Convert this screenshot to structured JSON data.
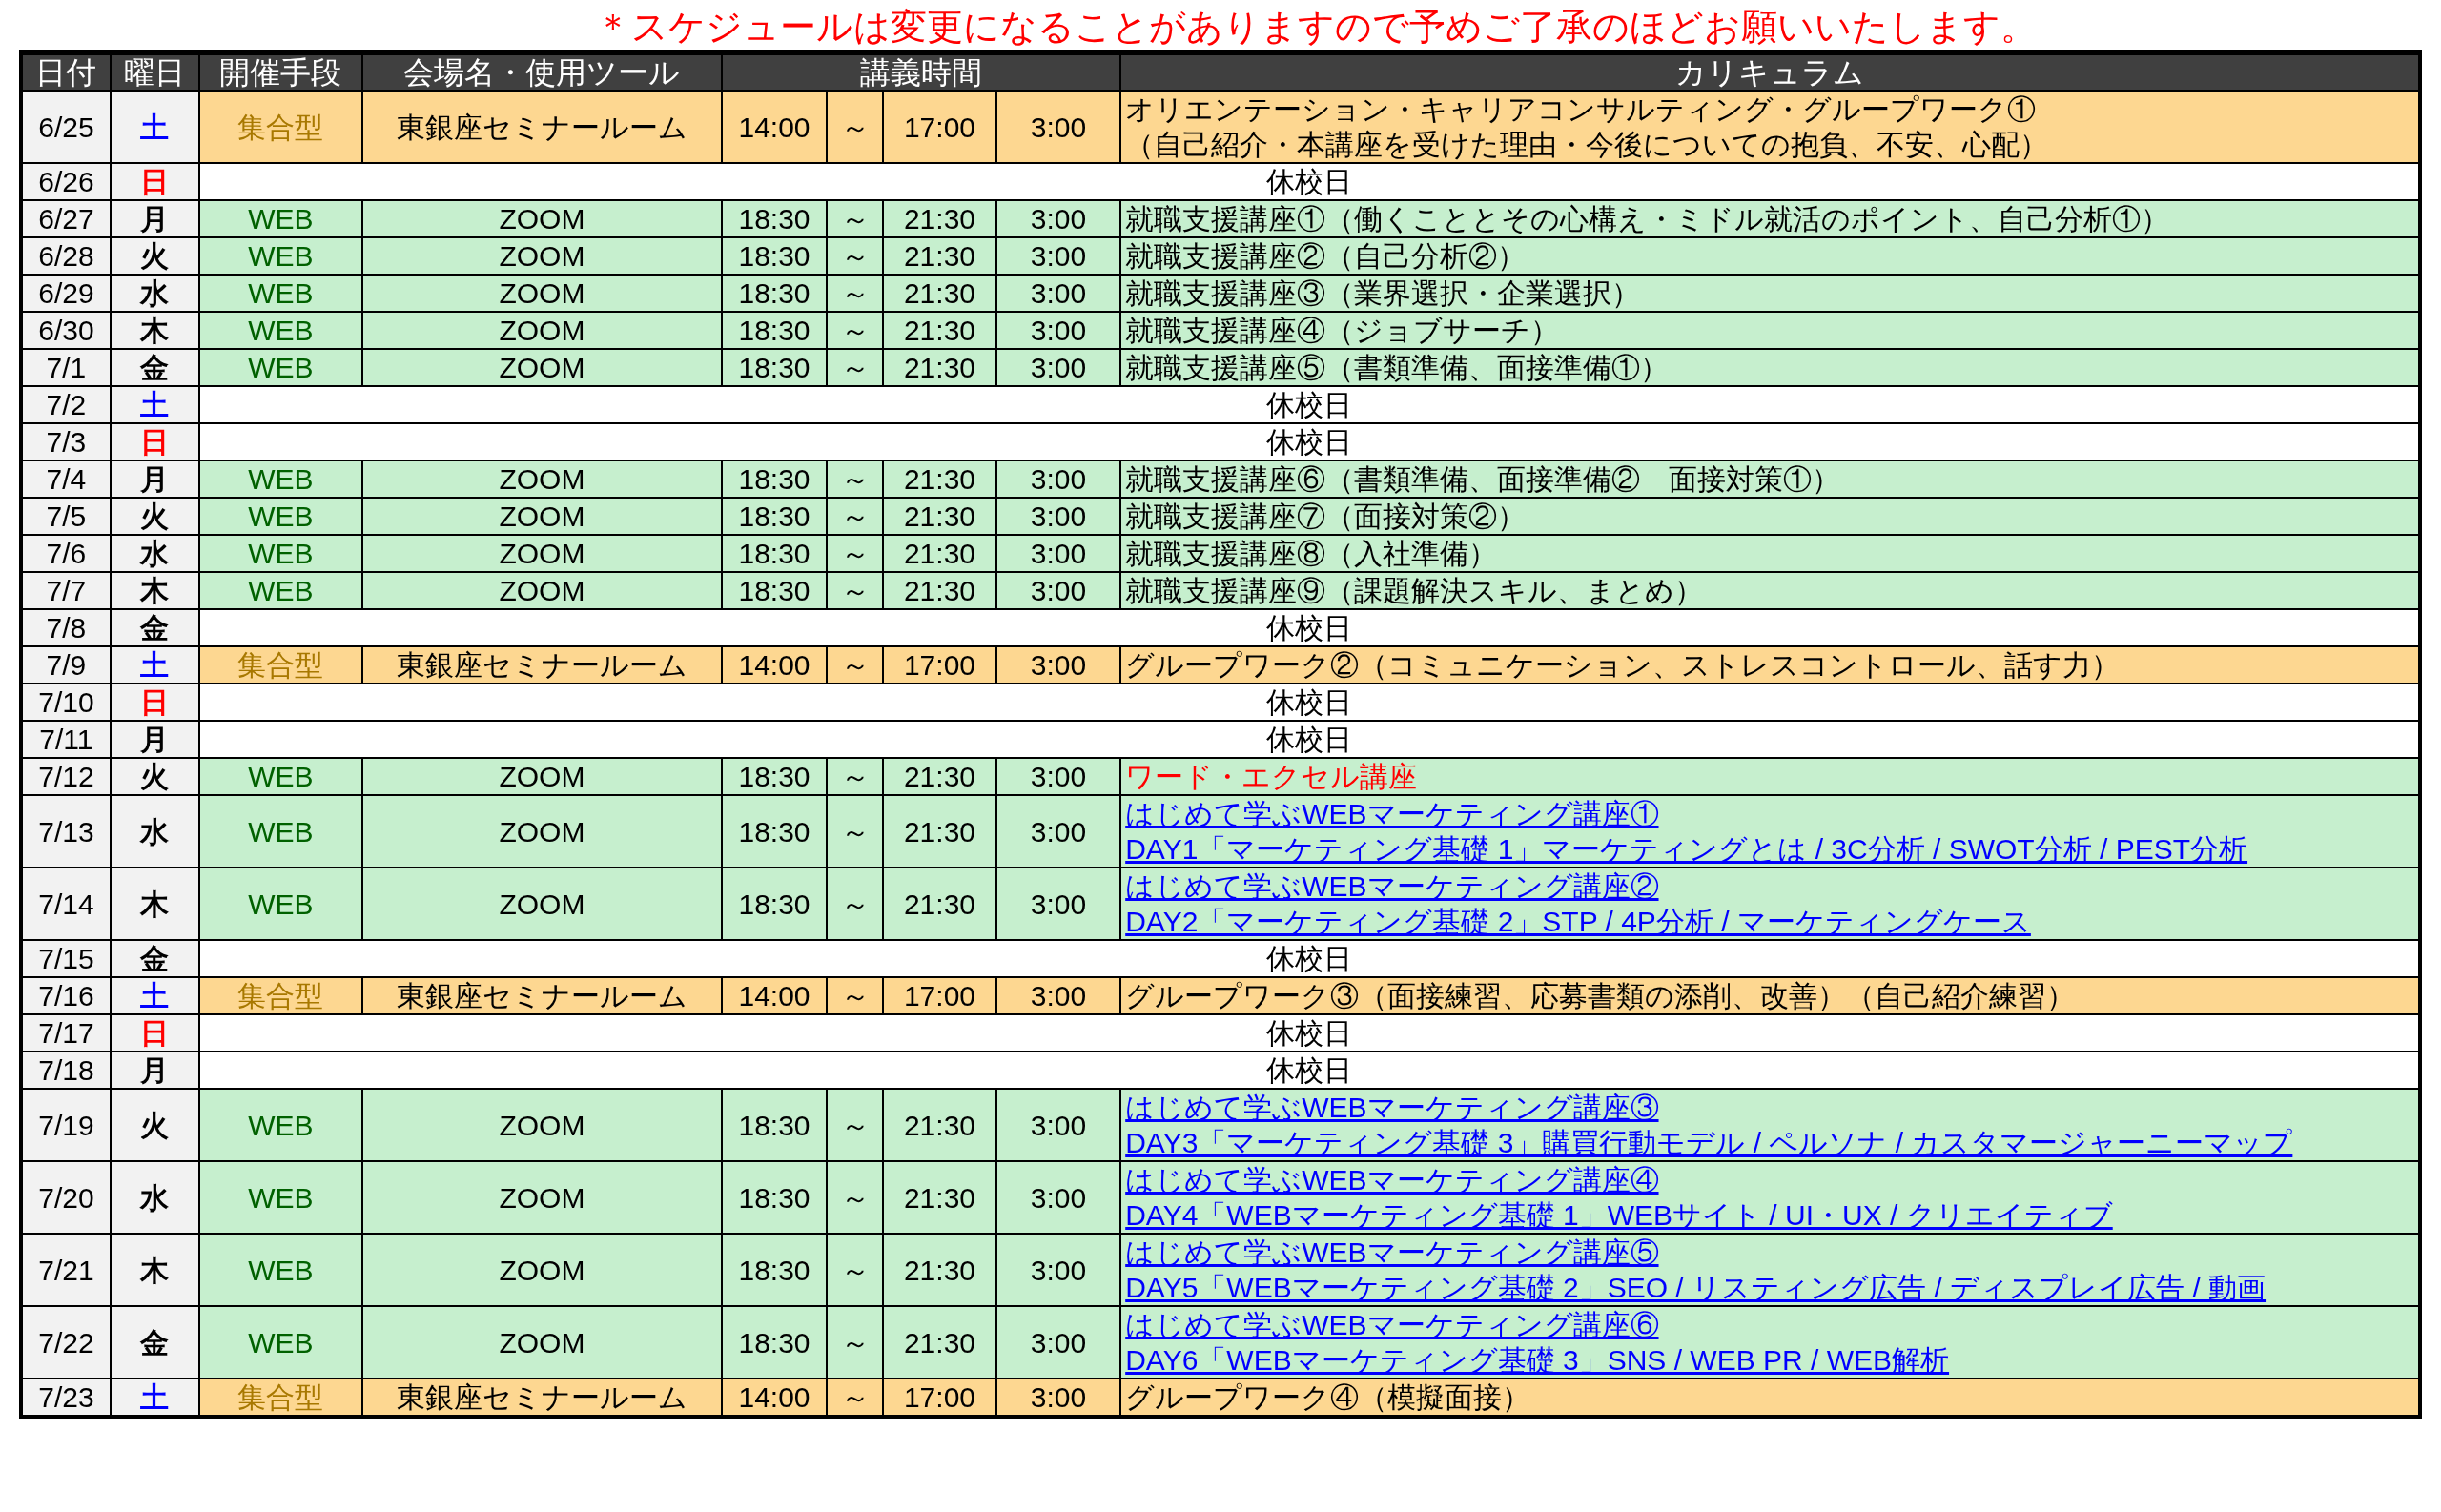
{
  "notice": "＊スケジュールは変更になることがありますので予めご了承のほどお願いいたします。",
  "header": [
    {
      "text": "日付",
      "kind": "single"
    },
    {
      "text": "曜日",
      "kind": "single"
    },
    {
      "text": "開催手段",
      "kind": "single"
    },
    {
      "text": "会場名・使用ツール",
      "kind": "single"
    },
    {
      "text": "講義時間",
      "kind": "time_group"
    },
    {
      "text": "カリキュラム",
      "kind": "single"
    }
  ],
  "rows": [
    {
      "kind": "in_person",
      "date": "6/25",
      "weekday": {
        "text": "土",
        "color": "#0000ff"
      },
      "mode": "集合型",
      "venue": "東銀座セミナールーム",
      "start": "14:00",
      "tilde": "～",
      "end": "17:00",
      "duration": "3:00",
      "curriculum": [
        {
          "kind": "plain",
          "text": "オリエンテーション・キャリアコンサルティング・グループワーク①"
        },
        {
          "kind": "plain",
          "text": "（自己紹介・本講座を受けた理由・今後についての抱負、不安、心配）"
        }
      ]
    },
    {
      "kind": "holiday",
      "date": "6/26",
      "weekday": {
        "text": "日",
        "color": "#ff0000"
      },
      "note": "休校日"
    },
    {
      "kind": "web",
      "date": "6/27",
      "weekday": {
        "text": "月",
        "color": "#000000"
      },
      "mode": "WEB",
      "venue": "ZOOM",
      "start": "18:30",
      "tilde": "～",
      "end": "21:30",
      "duration": "3:00",
      "curriculum": [
        {
          "kind": "plain",
          "text": "就職支援講座①（働くこととその心構え・ミドル就活のポイント、自己分析①）"
        }
      ]
    },
    {
      "kind": "web",
      "date": "6/28",
      "weekday": {
        "text": "火",
        "color": "#000000"
      },
      "mode": "WEB",
      "venue": "ZOOM",
      "start": "18:30",
      "tilde": "～",
      "end": "21:30",
      "duration": "3:00",
      "curriculum": [
        {
          "kind": "plain",
          "text": "就職支援講座②（自己分析②）"
        }
      ]
    },
    {
      "kind": "web",
      "date": "6/29",
      "weekday": {
        "text": "水",
        "color": "#000000"
      },
      "mode": "WEB",
      "venue": "ZOOM",
      "start": "18:30",
      "tilde": "～",
      "end": "21:30",
      "duration": "3:00",
      "curriculum": [
        {
          "kind": "plain",
          "text": "就職支援講座③（業界選択・企業選択）"
        }
      ]
    },
    {
      "kind": "web",
      "date": "6/30",
      "weekday": {
        "text": "木",
        "color": "#000000"
      },
      "mode": "WEB",
      "venue": "ZOOM",
      "start": "18:30",
      "tilde": "～",
      "end": "21:30",
      "duration": "3:00",
      "curriculum": [
        {
          "kind": "plain",
          "text": "就職支援講座④（ジョブサーチ）"
        }
      ]
    },
    {
      "kind": "web",
      "date": "7/1",
      "weekday": {
        "text": "金",
        "color": "#000000"
      },
      "mode": "WEB",
      "venue": "ZOOM",
      "start": "18:30",
      "tilde": "～",
      "end": "21:30",
      "duration": "3:00",
      "curriculum": [
        {
          "kind": "plain",
          "text": "就職支援講座⑤（書類準備、面接準備①）"
        }
      ]
    },
    {
      "kind": "holiday",
      "date": "7/2",
      "weekday": {
        "text": "土",
        "color": "#0000ff"
      },
      "note": "休校日"
    },
    {
      "kind": "holiday",
      "date": "7/3",
      "weekday": {
        "text": "日",
        "color": "#ff0000"
      },
      "note": "休校日"
    },
    {
      "kind": "web",
      "date": "7/4",
      "weekday": {
        "text": "月",
        "color": "#000000"
      },
      "mode": "WEB",
      "venue": "ZOOM",
      "start": "18:30",
      "tilde": "～",
      "end": "21:30",
      "duration": "3:00",
      "curriculum": [
        {
          "kind": "plain",
          "text": "就職支援講座⑥（書類準備、面接準備②　面接対策①）"
        }
      ]
    },
    {
      "kind": "web",
      "date": "7/5",
      "weekday": {
        "text": "火",
        "color": "#000000"
      },
      "mode": "WEB",
      "venue": "ZOOM",
      "start": "18:30",
      "tilde": "～",
      "end": "21:30",
      "duration": "3:00",
      "curriculum": [
        {
          "kind": "plain",
          "text": "就職支援講座⑦（面接対策②）"
        }
      ]
    },
    {
      "kind": "web",
      "date": "7/6",
      "weekday": {
        "text": "水",
        "color": "#000000"
      },
      "mode": "WEB",
      "venue": "ZOOM",
      "start": "18:30",
      "tilde": "～",
      "end": "21:30",
      "duration": "3:00",
      "curriculum": [
        {
          "kind": "plain",
          "text": "就職支援講座⑧（入社準備）"
        }
      ]
    },
    {
      "kind": "web",
      "date": "7/7",
      "weekday": {
        "text": "木",
        "color": "#000000"
      },
      "mode": "WEB",
      "venue": "ZOOM",
      "start": "18:30",
      "tilde": "～",
      "end": "21:30",
      "duration": "3:00",
      "curriculum": [
        {
          "kind": "plain",
          "text": "就職支援講座⑨（課題解決スキル、まとめ）"
        }
      ]
    },
    {
      "kind": "holiday",
      "date": "7/8",
      "weekday": {
        "text": "金",
        "color": "#000000"
      },
      "note": "休校日"
    },
    {
      "kind": "in_person",
      "date": "7/9",
      "weekday": {
        "text": "土",
        "color": "#0000ff"
      },
      "mode": "集合型",
      "venue": "東銀座セミナールーム",
      "start": "14:00",
      "tilde": "～",
      "end": "17:00",
      "duration": "3:00",
      "curriculum": [
        {
          "kind": "plain",
          "text": "グループワーク②（コミュニケーション、ストレスコントロール、話す力）"
        }
      ]
    },
    {
      "kind": "holiday",
      "date": "7/10",
      "weekday": {
        "text": "日",
        "color": "#ff0000"
      },
      "note": "休校日"
    },
    {
      "kind": "holiday",
      "date": "7/11",
      "weekday": {
        "text": "月",
        "color": "#000000"
      },
      "note": "休校日"
    },
    {
      "kind": "web",
      "date": "7/12",
      "weekday": {
        "text": "火",
        "color": "#000000"
      },
      "mode": "WEB",
      "venue": "ZOOM",
      "start": "18:30",
      "tilde": "～",
      "end": "21:30",
      "duration": "3:00",
      "curriculum": [
        {
          "kind": "alert",
          "text": "ワード・エクセル講座"
        }
      ]
    },
    {
      "kind": "web",
      "date": "7/13",
      "weekday": {
        "text": "水",
        "color": "#000000"
      },
      "mode": "WEB",
      "venue": "ZOOM",
      "start": "18:30",
      "tilde": "～",
      "end": "21:30",
      "duration": "3:00",
      "curriculum": [
        {
          "kind": "link",
          "text": "はじめて学ぶWEBマーケティング講座①"
        },
        {
          "kind": "link",
          "text": "DAY1「マーケティング基礎 1」マーケティングとは / 3C分析 / SWOT分析 / PEST分析"
        }
      ]
    },
    {
      "kind": "web",
      "date": "7/14",
      "weekday": {
        "text": "木",
        "color": "#000000"
      },
      "mode": "WEB",
      "venue": "ZOOM",
      "start": "18:30",
      "tilde": "～",
      "end": "21:30",
      "duration": "3:00",
      "curriculum": [
        {
          "kind": "link",
          "text": "はじめて学ぶWEBマーケティング講座②"
        },
        {
          "kind": "link",
          "text": "DAY2「マーケティング基礎 2」STP / 4P分析 / マーケティングケース"
        }
      ]
    },
    {
      "kind": "holiday",
      "date": "7/15",
      "weekday": {
        "text": "金",
        "color": "#000000"
      },
      "note": "休校日"
    },
    {
      "kind": "in_person",
      "date": "7/16",
      "weekday": {
        "text": "土",
        "color": "#0000ff"
      },
      "mode": "集合型",
      "venue": "東銀座セミナールーム",
      "start": "14:00",
      "tilde": "～",
      "end": "17:00",
      "duration": "3:00",
      "curriculum": [
        {
          "kind": "plain",
          "text": "グループワーク③（面接練習、応募書類の添削、改善）（自己紹介練習）"
        }
      ]
    },
    {
      "kind": "holiday",
      "date": "7/17",
      "weekday": {
        "text": "日",
        "color": "#ff0000"
      },
      "note": "休校日"
    },
    {
      "kind": "holiday",
      "date": "7/18",
      "weekday": {
        "text": "月",
        "color": "#000000"
      },
      "note": "休校日"
    },
    {
      "kind": "web",
      "date": "7/19",
      "weekday": {
        "text": "火",
        "color": "#000000"
      },
      "mode": "WEB",
      "venue": "ZOOM",
      "start": "18:30",
      "tilde": "～",
      "end": "21:30",
      "duration": "3:00",
      "curriculum": [
        {
          "kind": "link",
          "text": "はじめて学ぶWEBマーケティング講座③"
        },
        {
          "kind": "link",
          "text": "DAY3「マーケティング基礎 3」購買行動モデル / ペルソナ / カスタマージャーニーマップ"
        }
      ]
    },
    {
      "kind": "web",
      "date": "7/20",
      "weekday": {
        "text": "水",
        "color": "#000000"
      },
      "mode": "WEB",
      "venue": "ZOOM",
      "start": "18:30",
      "tilde": "～",
      "end": "21:30",
      "duration": "3:00",
      "curriculum": [
        {
          "kind": "link",
          "text": "はじめて学ぶWEBマーケティング講座④"
        },
        {
          "kind": "link",
          "text": "DAY4「WEBマーケティング基礎 1」WEBサイト / UI・UX / クリエイティブ"
        }
      ]
    },
    {
      "kind": "web",
      "date": "7/21",
      "weekday": {
        "text": "木",
        "color": "#000000"
      },
      "mode": "WEB",
      "venue": "ZOOM",
      "start": "18:30",
      "tilde": "～",
      "end": "21:30",
      "duration": "3:00",
      "curriculum": [
        {
          "kind": "link",
          "text": "はじめて学ぶWEBマーケティング講座⑤"
        },
        {
          "kind": "link",
          "text": "DAY5「WEBマーケティング基礎 2」SEO / リスティング広告 / ディスプレイ広告 / 動画"
        }
      ]
    },
    {
      "kind": "web",
      "date": "7/22",
      "weekday": {
        "text": "金",
        "color": "#000000"
      },
      "mode": "WEB",
      "venue": "ZOOM",
      "start": "18:30",
      "tilde": "～",
      "end": "21:30",
      "duration": "3:00",
      "curriculum": [
        {
          "kind": "link",
          "text": "はじめて学ぶWEBマーケティング講座⑥"
        },
        {
          "kind": "link",
          "text": "DAY6「WEBマーケティング基礎 3」SNS / WEB PR / WEB解析"
        }
      ]
    },
    {
      "kind": "in_person",
      "date": "7/23",
      "weekday": {
        "text": "土",
        "color": "#0000ff"
      },
      "mode": "集合型",
      "venue": "東銀座セミナールーム",
      "start": "14:00",
      "tilde": "～",
      "end": "17:00",
      "duration": "3:00",
      "curriculum": [
        {
          "kind": "plain",
          "text": "グループワーク④（模擬面接）"
        }
      ]
    }
  ]
}
